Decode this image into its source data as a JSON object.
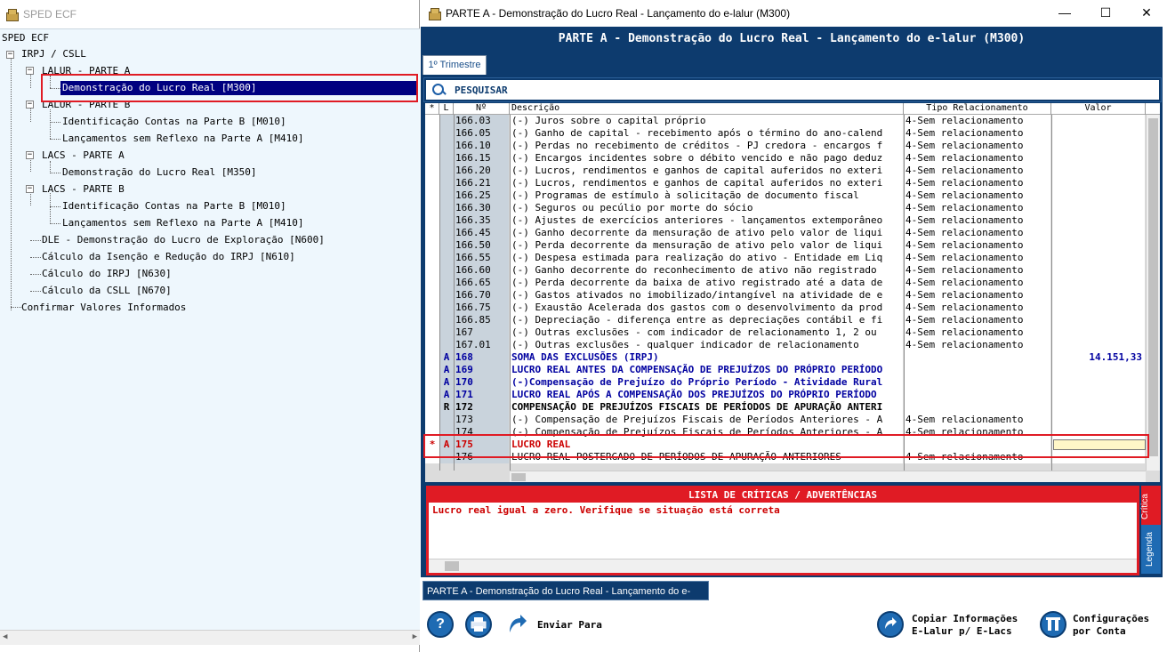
{
  "left_window": {
    "title": "SPED ECF",
    "tree": [
      {
        "label": "SPED ECF"
      },
      {
        "label": "IRPJ / CSLL"
      },
      {
        "label": "LALUR - PARTE A"
      },
      {
        "label": "Demonstração do Lucro Real [M300]"
      },
      {
        "label": "LALUR - PARTE B"
      },
      {
        "label": "Identificação Contas na Parte B [M010]"
      },
      {
        "label": "Lançamentos sem Reflexo na Parte A [M410]"
      },
      {
        "label": "LACS - PARTE A"
      },
      {
        "label": "Demonstração do Lucro Real [M350]"
      },
      {
        "label": "LACS - PARTE B"
      },
      {
        "label": "Identificação Contas na Parte B [M010]"
      },
      {
        "label": "Lançamentos sem Reflexo na Parte A [M410]"
      },
      {
        "label": "DLE - Demonstração do Lucro de Exploração [N600]"
      },
      {
        "label": "Cálculo da Isenção e Redução do IRPJ [N610]"
      },
      {
        "label": "Cálculo do IRPJ [N630]"
      },
      {
        "label": "Cálculo da CSLL [N670]"
      },
      {
        "label": "Confirmar Valores Informados"
      }
    ]
  },
  "right_window": {
    "title": "PARTE A - Demonstração do Lucro Real - Lançamento do e-lalur (M300)",
    "window_controls": {
      "minimize": "—",
      "maximize": "☐",
      "close": "✕"
    },
    "header": "PARTE A - Demonstração do Lucro Real - Lançamento do e-lalur (M300)",
    "tab": "1º Trimestre",
    "search_label": "PESQUISAR",
    "columns": {
      "star": "*",
      "l": "L",
      "n": "Nº",
      "desc": "Descrição",
      "tipo": "Tipo Relacionamento",
      "valor": "Valor"
    },
    "rows": [
      {
        "star": "",
        "l": "",
        "n": "166.03",
        "desc": "(-) Juros sobre o capital próprio",
        "tipo": "4-Sem relacionamento",
        "valor": "",
        "style": "normal"
      },
      {
        "star": "",
        "l": "",
        "n": "166.05",
        "desc": "(-) Ganho de capital - recebimento após o término do ano-calend",
        "tipo": "4-Sem relacionamento",
        "valor": "",
        "style": "normal"
      },
      {
        "star": "",
        "l": "",
        "n": "166.10",
        "desc": "(-) Perdas no recebimento de créditos - PJ credora - encargos f",
        "tipo": "4-Sem relacionamento",
        "valor": "",
        "style": "normal"
      },
      {
        "star": "",
        "l": "",
        "n": "166.15",
        "desc": "(-) Encargos incidentes sobre o débito vencido e não pago deduz",
        "tipo": "4-Sem relacionamento",
        "valor": "",
        "style": "normal"
      },
      {
        "star": "",
        "l": "",
        "n": "166.20",
        "desc": "(-) Lucros, rendimentos e ganhos de capital auferidos no exteri",
        "tipo": "4-Sem relacionamento",
        "valor": "",
        "style": "normal"
      },
      {
        "star": "",
        "l": "",
        "n": "166.21",
        "desc": "(-) Lucros, rendimentos e ganhos de capital auferidos no exteri",
        "tipo": "4-Sem relacionamento",
        "valor": "",
        "style": "normal"
      },
      {
        "star": "",
        "l": "",
        "n": "166.25",
        "desc": "(-) Programas de estímulo à solicitação de documento fiscal",
        "tipo": "4-Sem relacionamento",
        "valor": "",
        "style": "normal"
      },
      {
        "star": "",
        "l": "",
        "n": "166.30",
        "desc": "(-) Seguros ou pecúlio por morte do sócio",
        "tipo": "4-Sem relacionamento",
        "valor": "",
        "style": "normal"
      },
      {
        "star": "",
        "l": "",
        "n": "166.35",
        "desc": "(-) Ajustes de exercícios anteriores - lançamentos extemporâneo",
        "tipo": "4-Sem relacionamento",
        "valor": "",
        "style": "normal"
      },
      {
        "star": "",
        "l": "",
        "n": "166.45",
        "desc": "(-) Ganho decorrente da mensuração de ativo pelo valor de liqui",
        "tipo": "4-Sem relacionamento",
        "valor": "",
        "style": "normal"
      },
      {
        "star": "",
        "l": "",
        "n": "166.50",
        "desc": "(-) Perda decorrente da mensuração de ativo pelo valor de liqui",
        "tipo": "4-Sem relacionamento",
        "valor": "",
        "style": "normal"
      },
      {
        "star": "",
        "l": "",
        "n": "166.55",
        "desc": "(-) Despesa estimada para realização do ativo - Entidade em Liq",
        "tipo": "4-Sem relacionamento",
        "valor": "",
        "style": "normal"
      },
      {
        "star": "",
        "l": "",
        "n": "166.60",
        "desc": "(-) Ganho decorrente do reconhecimento de ativo não registrado",
        "tipo": "4-Sem relacionamento",
        "valor": "",
        "style": "normal"
      },
      {
        "star": "",
        "l": "",
        "n": "166.65",
        "desc": "(-) Perda decorrente da baixa de ativo registrado até a data de",
        "tipo": "4-Sem relacionamento",
        "valor": "",
        "style": "normal"
      },
      {
        "star": "",
        "l": "",
        "n": "166.70",
        "desc": "(-) Gastos ativados no imobilizado/intangível na atividade de e",
        "tipo": "4-Sem relacionamento",
        "valor": "",
        "style": "normal"
      },
      {
        "star": "",
        "l": "",
        "n": "166.75",
        "desc": "(-) Exaustão Acelerada dos gastos com o desenvolvimento da prod",
        "tipo": "4-Sem relacionamento",
        "valor": "",
        "style": "normal"
      },
      {
        "star": "",
        "l": "",
        "n": "166.85",
        "desc": "(-) Depreciação - diferença entre as depreciações contábil e fi",
        "tipo": "4-Sem relacionamento",
        "valor": "",
        "style": "normal"
      },
      {
        "star": "",
        "l": "",
        "n": "167",
        "desc": "(-) Outras exclusões - com indicador de relacionamento 1, 2 ou",
        "tipo": "4-Sem relacionamento",
        "valor": "",
        "style": "normal"
      },
      {
        "star": "",
        "l": "",
        "n": "167.01",
        "desc": "(-) Outras exclusões - qualquer indicador de relacionamento",
        "tipo": "4-Sem relacionamento",
        "valor": "",
        "style": "normal"
      },
      {
        "star": "",
        "l": "A",
        "n": "168",
        "desc": "SOMA DAS EXCLUSÕES (IRPJ)",
        "tipo": "",
        "valor": "14.151,33",
        "style": "blue"
      },
      {
        "star": "",
        "l": "A",
        "n": "169",
        "desc": "LUCRO REAL ANTES DA COMPENSAÇÃO DE PREJUÍZOS DO PRÓPRIO PERÍODO",
        "tipo": "",
        "valor": "",
        "style": "blue"
      },
      {
        "star": "",
        "l": "A",
        "n": "170",
        "desc": "(-)Compensação de Prejuízo do Próprio Período - Atividade Rural",
        "tipo": "",
        "valor": "",
        "style": "blue"
      },
      {
        "star": "",
        "l": "A",
        "n": "171",
        "desc": "LUCRO REAL APÓS A COMPENSAÇÃO DOS PREJUÍZOS DO PRÓPRIO PERÍODO",
        "tipo": "",
        "valor": "",
        "style": "blue"
      },
      {
        "star": "",
        "l": "R",
        "n": "172",
        "desc": "COMPENSAÇÃO DE PREJUÍZOS FISCAIS DE PERÍODOS DE APURAÇÃO ANTERI",
        "tipo": "",
        "valor": "",
        "style": "black"
      },
      {
        "star": "",
        "l": "",
        "n": "173",
        "desc": "(-) Compensação de Prejuízos Fiscais de Períodos Anteriores - A",
        "tipo": "4-Sem relacionamento",
        "valor": "",
        "style": "normal"
      },
      {
        "star": "",
        "l": "",
        "n": "174",
        "desc": "(-) Compensação de Prejuízos Fiscais de Períodos Anteriores - A",
        "tipo": "4-Sem relacionamento",
        "valor": "",
        "style": "normal"
      },
      {
        "star": "*",
        "l": "A",
        "n": "175",
        "desc": "LUCRO REAL",
        "tipo": "",
        "valor": "",
        "style": "red"
      },
      {
        "star": "",
        "l": "",
        "n": "176",
        "desc": "LUCRO REAL POSTERGADO DE PERÍODOS DE APURAÇÃO ANTERIORES",
        "tipo": "4-Sem relacionamento",
        "valor": "",
        "style": "normal"
      }
    ],
    "criticas": {
      "title": "LISTA DE CRÍTICAS / ADVERTÊNCIAS",
      "message": "Lucro real igual a zero. Verifique se situação está correta",
      "tab_critica": "Crítica",
      "tab_legenda": "Legenda"
    },
    "bottom_tab": "PARTE A - Demonstração do Lucro Real - Lançamento do e-lalur",
    "buttons": {
      "help": "?",
      "enviar": "Enviar Para",
      "copiar_line1": "Copiar Informações",
      "copiar_line2": "E-Lalur p/ E-Lacs",
      "config_line1": "Configurações",
      "config_line2": "por Conta"
    }
  },
  "colors": {
    "header_blue": "#0d3b6e",
    "highlight_red": "#e01b24",
    "tree_bg": "#eef7fd",
    "selected": "#000080"
  }
}
